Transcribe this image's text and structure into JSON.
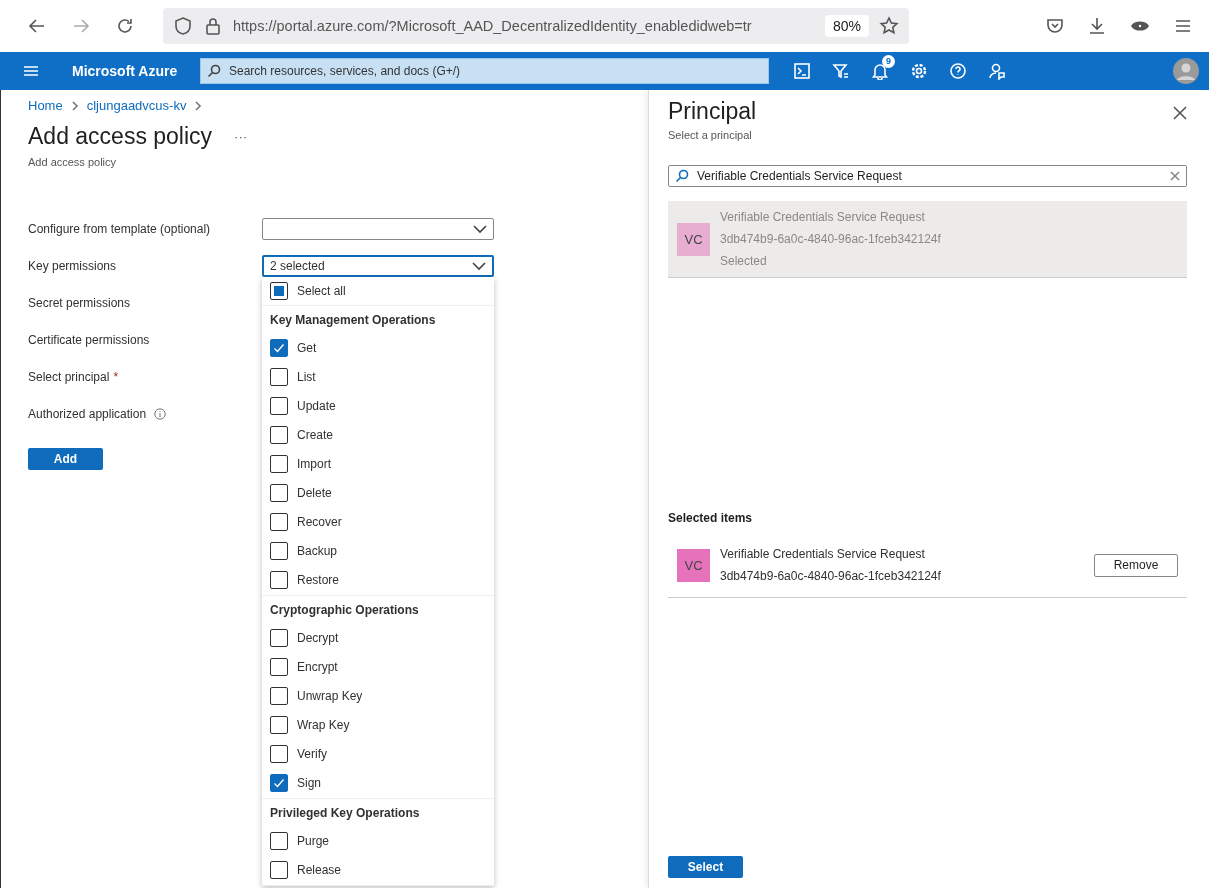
{
  "browser": {
    "url": "https://portal.azure.com/?Microsoft_AAD_DecentralizedIdentity_enabledidweb=tr",
    "zoom": "80%"
  },
  "topbar": {
    "brand": "Microsoft Azure",
    "search_placeholder": "Search resources, services, and docs (G+/)",
    "notification_count": "9"
  },
  "breadcrumb": [
    "Home",
    "cljungaadvcus-kv"
  ],
  "page": {
    "title": "Add access policy",
    "more": "···",
    "subtitle": "Add access policy"
  },
  "form": [
    {
      "label": "Configure from template (optional)",
      "kind": "dropdown"
    },
    {
      "label": "Key permissions",
      "kind": "dropdown",
      "value": "2 selected",
      "open": true
    },
    {
      "label": "Secret permissions",
      "kind": "plain"
    },
    {
      "label": "Certificate permissions",
      "kind": "plain"
    },
    {
      "label": "Select principal",
      "kind": "plain",
      "required_marker": "*"
    },
    {
      "label": "Authorized application",
      "kind": "plain",
      "info": true
    }
  ],
  "add_button": "Add",
  "key_menu": {
    "select_all": {
      "label": "Select all",
      "checked": false,
      "mixed": true
    },
    "groups": [
      {
        "title": "Key Management Operations",
        "items": [
          {
            "label": "Get",
            "checked": true
          },
          {
            "label": "List",
            "checked": false
          },
          {
            "label": "Update",
            "checked": false
          },
          {
            "label": "Create",
            "checked": false
          },
          {
            "label": "Import",
            "checked": false
          },
          {
            "label": "Delete",
            "checked": false
          },
          {
            "label": "Recover",
            "checked": false
          },
          {
            "label": "Backup",
            "checked": false
          },
          {
            "label": "Restore",
            "checked": false
          }
        ]
      },
      {
        "title": "Cryptographic Operations",
        "items": [
          {
            "label": "Decrypt",
            "checked": false
          },
          {
            "label": "Encrypt",
            "checked": false
          },
          {
            "label": "Unwrap Key",
            "checked": false
          },
          {
            "label": "Wrap Key",
            "checked": false
          },
          {
            "label": "Verify",
            "checked": false
          },
          {
            "label": "Sign",
            "checked": true
          }
        ]
      },
      {
        "title": "Privileged Key Operations",
        "items": [
          {
            "label": "Purge",
            "checked": false
          },
          {
            "label": "Release",
            "checked": false
          }
        ]
      }
    ]
  },
  "panel": {
    "title": "Principal",
    "subtitle": "Select a principal",
    "search_value": "Verifiable Credentials Service Request",
    "results": [
      {
        "initials": "VC",
        "name": "Verifiable Credentials Service Request",
        "id": "3db474b9-6a0c-4840-96ac-1fceb342124f",
        "status": "Selected",
        "selected": true,
        "color": "#e8aed2"
      }
    ],
    "selected_heading": "Selected items",
    "selected_items": [
      {
        "initials": "VC",
        "name": "Verifiable Credentials Service Request",
        "id": "3db474b9-6a0c-4840-96ac-1fceb342124f",
        "color": "#e672bc",
        "action": "Remove"
      }
    ],
    "select_button": "Select"
  }
}
